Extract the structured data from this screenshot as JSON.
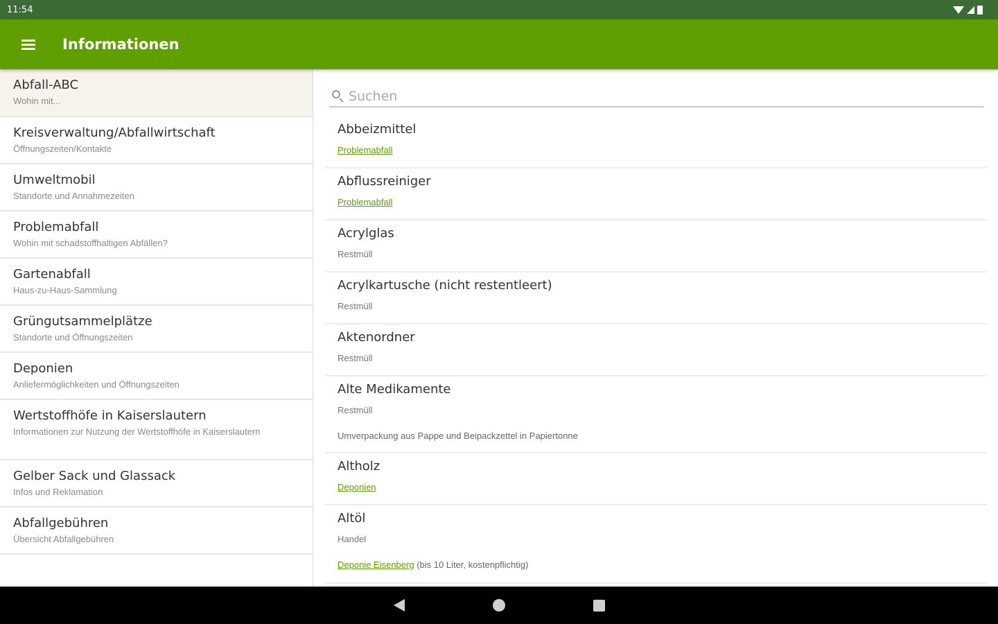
{
  "status": {
    "time": "11:54"
  },
  "appbar": {
    "title": "Informationen"
  },
  "sidebar": {
    "items": [
      {
        "title": "Abfall-ABC",
        "subtitle": "Wohin mit..."
      },
      {
        "title": "Kreisverwaltung/Abfallwirtschaft",
        "subtitle": "Öffnungszeiten/Kontakte"
      },
      {
        "title": "Umweltmobil",
        "subtitle": "Standorte und Annahmezeiten"
      },
      {
        "title": "Problemabfall",
        "subtitle": "Wohin mit schadstoffhaltigen Abfällen?"
      },
      {
        "title": "Gartenabfall",
        "subtitle": "Haus-zu-Haus-Sammlung"
      },
      {
        "title": "Grüngutsammelplätze",
        "subtitle": "Standorte und Öffnungszeiten"
      },
      {
        "title": "Deponien",
        "subtitle": "Anliefermöglichkeiten und Öffnungszeiten"
      },
      {
        "title": "Wertstoffhöfe in Kaiserslautern",
        "subtitle": "Informationen zur Nutzung der Wertstoffhöfe in Kaiserslautern"
      },
      {
        "title": "Gelber Sack und Glassack",
        "subtitle": "Infos und Reklamation"
      },
      {
        "title": "Abfallgebühren",
        "subtitle": "Übersicht Abfallgebühren"
      }
    ]
  },
  "search": {
    "placeholder": "Suchen"
  },
  "results": [
    {
      "title": "Abbeizmittel",
      "category": "Problemabfall"
    },
    {
      "title": "Abflussreiniger",
      "category": "Problemabfall"
    },
    {
      "title": "Acrylglas",
      "category": "Restmüll"
    },
    {
      "title": "Acrylkartusche (nicht restentleert)",
      "category": "Restmüll"
    },
    {
      "title": "Aktenordner",
      "category": "Restmüll"
    },
    {
      "title": "Alte Medikamente",
      "category": "Restmüll",
      "note": "Umverpackung aus Pappe und Beipackzettel in Papiertonne"
    },
    {
      "title": "Altholz",
      "category": "Deponien"
    },
    {
      "title": "Altöl",
      "category": "Handel",
      "note_link": "Deponie Eisenberg",
      "note_rest": " (bis 10 Liter, kostenpflichtig)"
    }
  ],
  "colors": {
    "appbar": "#5fa000",
    "statusbar": "#3d6b35",
    "link": "#5fa000",
    "active_item": "#f5f3ec"
  },
  "icons": {
    "menu": "hamburger-menu-icon",
    "search": "magnifier-icon",
    "back": "back-triangle-icon",
    "home": "home-circle-icon",
    "recent": "recent-square-icon"
  }
}
